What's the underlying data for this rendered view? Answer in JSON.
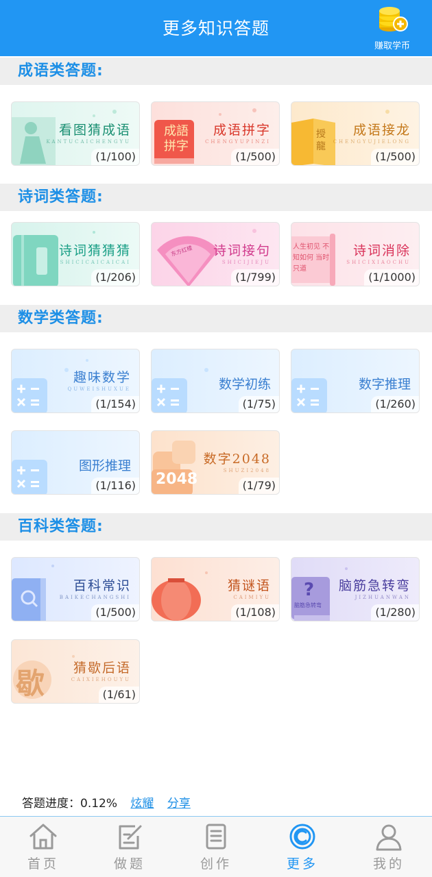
{
  "header": {
    "title": "更多知识答题",
    "earn_label": "赚取学币",
    "accent": "#2196f3"
  },
  "sections": [
    {
      "title": "成语类答题:",
      "items": [
        {
          "name": "看图猜成语",
          "sub": "KANTUCAICHENGYU",
          "count": "(1/100)",
          "icon": "scholar-icon"
        },
        {
          "name": "成语拼字",
          "sub": "CHENGYUPINZI",
          "count": "(1/500)",
          "icon": "red-book-icon",
          "badge": "成語拼字"
        },
        {
          "name": "成语接龙",
          "sub": "CHENGYUJIELONG",
          "count": "(1/500)",
          "icon": "yellow-book-icon",
          "badge": "授 龍"
        }
      ]
    },
    {
      "title": "诗词类答题:",
      "items": [
        {
          "name": "诗词猜猜猜",
          "sub": "SHICICAICAICAI",
          "count": "(1/206)",
          "icon": "teal-book-icon"
        },
        {
          "name": "诗词接句",
          "sub": "SHICIJIEJU",
          "count": "(1/799)",
          "icon": "fan-icon",
          "badge": "东方红楼"
        },
        {
          "name": "诗词消除",
          "sub": "SHICIXIAOCHU",
          "count": "(1/1000)",
          "icon": "scroll-icon",
          "badge": "人生初见 不知如何 当时只道"
        }
      ]
    },
    {
      "title": "数学类答题:",
      "items": [
        {
          "name": "趣味数学",
          "sub": "QUWEISHUXUE",
          "count": "(1/154)",
          "icon": "calculator-icon"
        },
        {
          "name": "数学初练",
          "sub": "",
          "count": "(1/75)",
          "icon": "calculator-icon"
        },
        {
          "name": "数字推理",
          "sub": "",
          "count": "(1/260)",
          "icon": "calculator-icon"
        },
        {
          "name": "图形推理",
          "sub": "",
          "count": "(1/116)",
          "icon": "calculator-icon"
        },
        {
          "name": "数字2048",
          "sub": "SHUZI2048",
          "count": "(1/79)",
          "icon": "tiles-2048-icon",
          "badge": "2048"
        }
      ]
    },
    {
      "title": "百科类答题:",
      "items": [
        {
          "name": "百科常识",
          "sub": "BAIKECHANGSHI",
          "count": "(1/500)",
          "icon": "search-book-icon"
        },
        {
          "name": "猜谜语",
          "sub": "CAIMIYU",
          "count": "(1/108)",
          "icon": "lantern-icon"
        },
        {
          "name": "脑筋急转弯",
          "sub": "JIZHUANWAN",
          "count": "(1/280)",
          "icon": "question-book-icon",
          "badge": "脑筋急转弯"
        },
        {
          "name": "猜歇后语",
          "sub": "CAIXIEHOUYU",
          "count": "(1/61)",
          "icon": "brush-char-icon",
          "badge": "歇"
        }
      ]
    }
  ],
  "progress": {
    "label": "答题进度：0.12%",
    "show_off": "炫耀",
    "share": "分享"
  },
  "tabbar": [
    {
      "label": "首页",
      "icon": "home-icon",
      "active": false
    },
    {
      "label": "做题",
      "icon": "edit-icon",
      "active": false
    },
    {
      "label": "创作",
      "icon": "document-icon",
      "active": false
    },
    {
      "label": "更多",
      "icon": "more-icon",
      "active": true
    },
    {
      "label": "我的",
      "icon": "user-icon",
      "active": false
    }
  ]
}
